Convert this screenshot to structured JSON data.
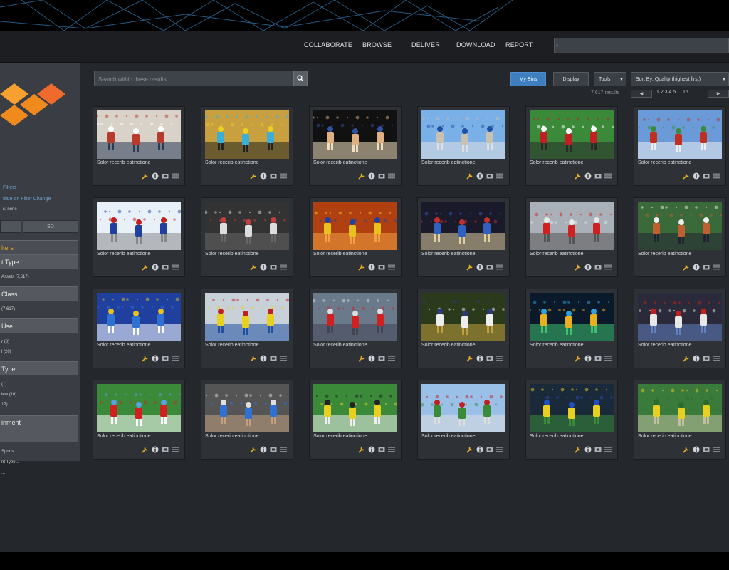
{
  "topnav": {
    "items": [
      "COLLABORATE",
      "BROWSE",
      "DELIVER",
      "DOWNLOAD",
      "REPORT"
    ]
  },
  "sidebar": {
    "filters_link": "Filters",
    "update_link": "date on Filter Change",
    "note": "s: none",
    "btn_left": "",
    "btn_right": "SD",
    "sections": [
      {
        "title": "lters",
        "highlight": true,
        "items": []
      },
      {
        "title": "t Type",
        "highlight": false,
        "items": [
          "Assets (7,617)"
        ]
      },
      {
        "title": "Class",
        "highlight": false,
        "items": [
          "(7,617)"
        ]
      },
      {
        "title": "Use",
        "highlight": false,
        "items": [
          "r (8)",
          "l (20)"
        ]
      },
      {
        "title": "Type",
        "highlight": false,
        "items": [
          "(1)",
          "iew (16)",
          "17)"
        ]
      },
      {
        "title": "inment",
        "highlight": false,
        "items": [
          "Sports...",
          "nt Type...",
          "..."
        ]
      }
    ]
  },
  "toolbar": {
    "search_placeholder": "Search within these results...",
    "my_bins": "My Bins",
    "display": "Display",
    "tools": "Tools",
    "sort": "Sort By: Quality (highest first)",
    "count": "7,617 results",
    "pages": "1 2 3 4 5 ... 15"
  },
  "assets": {
    "caption": "Solor recerib eatinctione",
    "thumbs": [
      "baseball-players",
      "cycling-race",
      "boxing-match",
      "racetrack-grandstand",
      "football-stadium",
      "stadium-crowd",
      "skiing",
      "soccer-goal-net",
      "basketball-dunk",
      "boxing-ring-aerial",
      "drag-racing",
      "american-football-tackle",
      "soccer-trophy-team",
      "cyclist-finish",
      "formula-one",
      "football-huddle",
      "world-cup-trophy",
      "celebration-crowd",
      "soccer-duel",
      "goalkeeper-crowd",
      "rugby-tackle",
      "stadium-wide",
      "bicycle-kick",
      "soccer-fans"
    ]
  },
  "colors": {
    "accent": "#3f7fbf",
    "logo_orange": "#f08a1c",
    "highlight": "#e8a020"
  }
}
